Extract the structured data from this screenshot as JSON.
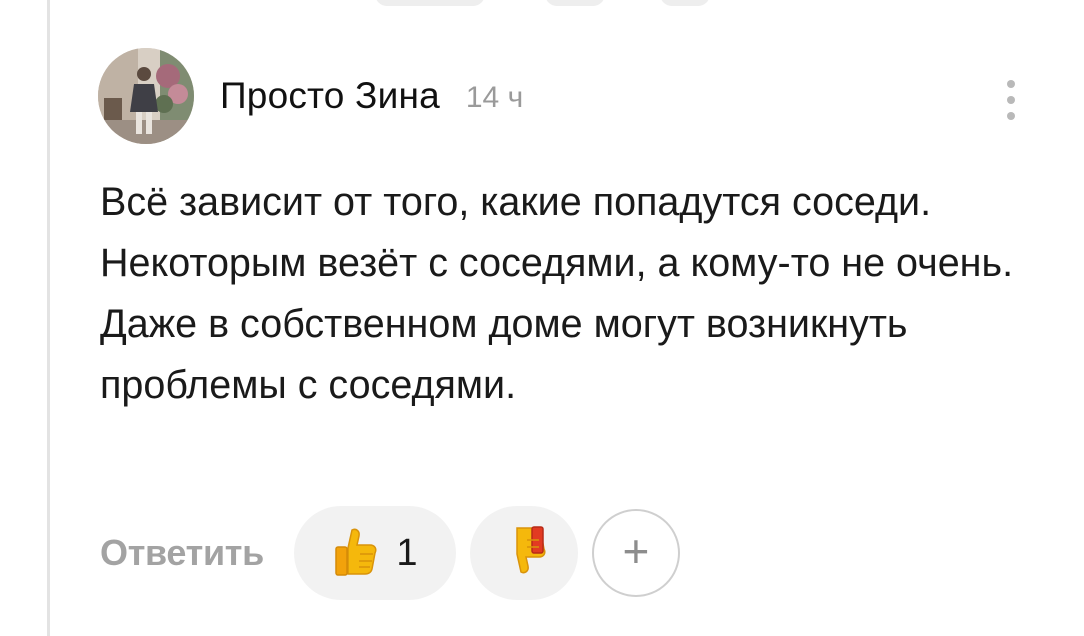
{
  "comment": {
    "author": "Просто Зина",
    "time": "14 ч",
    "text": "Всё зависит от того, какие попадутся соседи. Некоторым везёт с соседями, а кому-то не очень. Даже в собственном доме могут возникнуть проблемы с соседями."
  },
  "actions": {
    "reply_label": "Ответить",
    "like_count": "1",
    "like_icon": "thumbs-up-icon",
    "dislike_icon": "thumbs-down-icon",
    "add_reaction_label": "+"
  },
  "colors": {
    "text": "#1a1a1a",
    "muted": "#9a9a9a",
    "pill_bg": "#f2f2f2",
    "emoji_yellow": "#f5b80c"
  }
}
